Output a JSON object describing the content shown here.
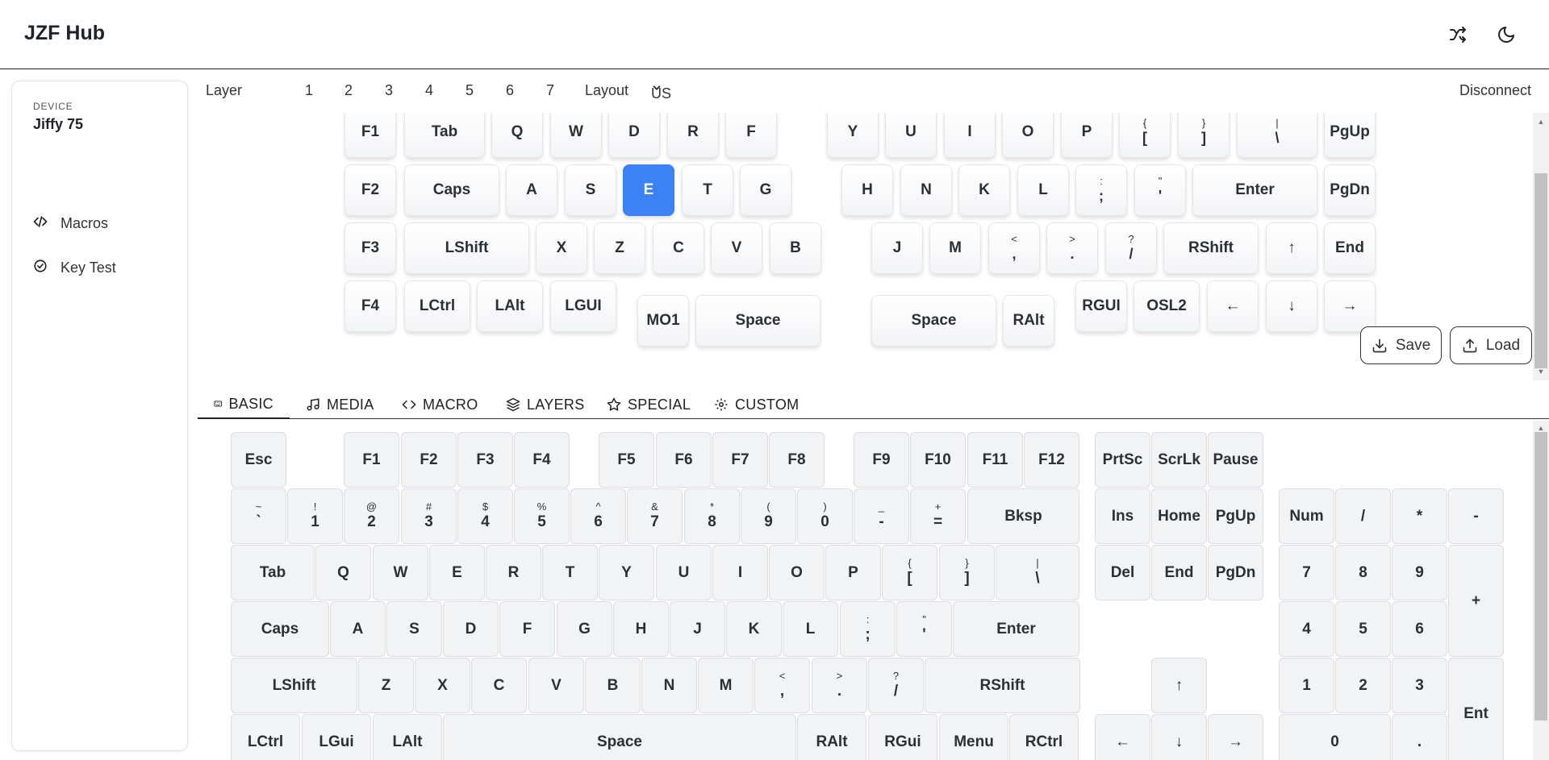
{
  "app": {
    "title": "JZF Hub"
  },
  "header": {
    "icons": [
      "shuffle-icon",
      "moon-icon"
    ]
  },
  "sidebar": {
    "device_label": "DEVICE",
    "device_name": "Jiffy 75",
    "items": [
      {
        "label": "Macros",
        "icon": "code-icon"
      },
      {
        "label": "Key Test",
        "icon": "check-circle-icon"
      }
    ]
  },
  "topbar": {
    "layer_label": "Layer",
    "layers": [
      "1",
      "2",
      "3",
      "4",
      "5",
      "6",
      "7"
    ],
    "layout_label": "Layout",
    "layout_value": "US",
    "disconnect_label": "Disconnect"
  },
  "actions": {
    "save_label": "Save",
    "load_label": "Load"
  },
  "keymap": {
    "selected": "E",
    "keys": [
      {
        "l": "F1"
      },
      {
        "l": "Tab"
      },
      {
        "l": "Q"
      },
      {
        "l": "W"
      },
      {
        "l": "D"
      },
      {
        "l": "R"
      },
      {
        "l": "F"
      },
      {
        "l": "Y"
      },
      {
        "l": "U"
      },
      {
        "l": "I"
      },
      {
        "l": "O"
      },
      {
        "l": "P"
      },
      {
        "s": "{",
        "l": "["
      },
      {
        "s": "}",
        "l": "]"
      },
      {
        "s": "|",
        "l": "\\"
      },
      {
        "l": "PgUp"
      },
      {
        "l": "F2"
      },
      {
        "l": "Caps"
      },
      {
        "l": "A"
      },
      {
        "l": "S"
      },
      {
        "l": "E"
      },
      {
        "l": "T"
      },
      {
        "l": "G"
      },
      {
        "l": "H"
      },
      {
        "l": "N"
      },
      {
        "l": "K"
      },
      {
        "l": "L"
      },
      {
        "s": ":",
        "l": ";"
      },
      {
        "s": "\"",
        "l": "'"
      },
      {
        "l": "Enter"
      },
      {
        "l": "PgDn"
      },
      {
        "l": "F3"
      },
      {
        "l": "LShift"
      },
      {
        "l": "X"
      },
      {
        "l": "Z"
      },
      {
        "l": "C"
      },
      {
        "l": "V"
      },
      {
        "l": "B"
      },
      {
        "l": "J"
      },
      {
        "l": "M"
      },
      {
        "s": "<",
        "l": ","
      },
      {
        "s": ">",
        "l": "."
      },
      {
        "s": "?",
        "l": "/"
      },
      {
        "l": "RShift"
      },
      {
        "l": "↑"
      },
      {
        "l": "End"
      },
      {
        "l": "F4"
      },
      {
        "l": "LCtrl"
      },
      {
        "l": "LAlt"
      },
      {
        "l": "LGUI"
      },
      {
        "l": "MO1"
      },
      {
        "l": "Space"
      },
      {
        "l": "Space"
      },
      {
        "l": "RAlt"
      },
      {
        "l": "RGUI"
      },
      {
        "l": "OSL2"
      },
      {
        "l": "←"
      },
      {
        "l": "↓"
      },
      {
        "l": "→"
      }
    ]
  },
  "tabs": [
    {
      "label": "BASIC",
      "icon": "keyboard-icon",
      "active": true
    },
    {
      "label": "MEDIA",
      "icon": "music-icon"
    },
    {
      "label": "MACRO",
      "icon": "code-icon"
    },
    {
      "label": "LAYERS",
      "icon": "layers-icon"
    },
    {
      "label": "SPECIAL",
      "icon": "star-icon"
    },
    {
      "label": "CUSTOM",
      "icon": "gear-icon"
    }
  ],
  "palette": {
    "keys": [
      {
        "l": "Esc"
      },
      {
        "l": "F1"
      },
      {
        "l": "F2"
      },
      {
        "l": "F3"
      },
      {
        "l": "F4"
      },
      {
        "l": "F5"
      },
      {
        "l": "F6"
      },
      {
        "l": "F7"
      },
      {
        "l": "F8"
      },
      {
        "l": "F9"
      },
      {
        "l": "F10"
      },
      {
        "l": "F11"
      },
      {
        "l": "F12"
      },
      {
        "l": "PrtSc"
      },
      {
        "l": "ScrLk"
      },
      {
        "l": "Pause"
      },
      {
        "s": "~",
        "l": "`"
      },
      {
        "s": "!",
        "l": "1"
      },
      {
        "s": "@",
        "l": "2"
      },
      {
        "s": "#",
        "l": "3"
      },
      {
        "s": "$",
        "l": "4"
      },
      {
        "s": "%",
        "l": "5"
      },
      {
        "s": "^",
        "l": "6"
      },
      {
        "s": "&",
        "l": "7"
      },
      {
        "s": "*",
        "l": "8"
      },
      {
        "s": "(",
        "l": "9"
      },
      {
        "s": ")",
        "l": "0"
      },
      {
        "s": "_",
        "l": "-"
      },
      {
        "s": "+",
        "l": "="
      },
      {
        "l": "Bksp"
      },
      {
        "l": "Ins"
      },
      {
        "l": "Home"
      },
      {
        "l": "PgUp"
      },
      {
        "l": "Num"
      },
      {
        "l": "/"
      },
      {
        "l": "*"
      },
      {
        "l": "-"
      },
      {
        "l": "Tab"
      },
      {
        "l": "Q"
      },
      {
        "l": "W"
      },
      {
        "l": "E"
      },
      {
        "l": "R"
      },
      {
        "l": "T"
      },
      {
        "l": "Y"
      },
      {
        "l": "U"
      },
      {
        "l": "I"
      },
      {
        "l": "O"
      },
      {
        "l": "P"
      },
      {
        "s": "{",
        "l": "["
      },
      {
        "s": "}",
        "l": "]"
      },
      {
        "s": "|",
        "l": "\\"
      },
      {
        "l": "Del"
      },
      {
        "l": "End"
      },
      {
        "l": "PgDn"
      },
      {
        "l": "7"
      },
      {
        "l": "8"
      },
      {
        "l": "9"
      },
      {
        "l": "+"
      },
      {
        "l": "Caps"
      },
      {
        "l": "A"
      },
      {
        "l": "S"
      },
      {
        "l": "D"
      },
      {
        "l": "F"
      },
      {
        "l": "G"
      },
      {
        "l": "H"
      },
      {
        "l": "J"
      },
      {
        "l": "K"
      },
      {
        "l": "L"
      },
      {
        "s": ":",
        "l": ";"
      },
      {
        "s": "\"",
        "l": "'"
      },
      {
        "l": "Enter"
      },
      {
        "l": "4"
      },
      {
        "l": "5"
      },
      {
        "l": "6"
      },
      {
        "l": "LShift"
      },
      {
        "l": "Z"
      },
      {
        "l": "X"
      },
      {
        "l": "C"
      },
      {
        "l": "V"
      },
      {
        "l": "B"
      },
      {
        "l": "N"
      },
      {
        "l": "M"
      },
      {
        "s": "<",
        "l": ","
      },
      {
        "s": ">",
        "l": "."
      },
      {
        "s": "?",
        "l": "/"
      },
      {
        "l": "RShift"
      },
      {
        "l": "↑"
      },
      {
        "l": "1"
      },
      {
        "l": "2"
      },
      {
        "l": "3"
      },
      {
        "l": "Ent"
      },
      {
        "l": "LCtrl"
      },
      {
        "l": "LGui"
      },
      {
        "l": "LAlt"
      },
      {
        "l": "Space"
      },
      {
        "l": "RAlt"
      },
      {
        "l": "RGui"
      },
      {
        "l": "Menu"
      },
      {
        "l": "RCtrl"
      },
      {
        "l": "←"
      },
      {
        "l": "↓"
      },
      {
        "l": "→"
      },
      {
        "l": "0"
      },
      {
        "l": "."
      }
    ]
  },
  "colors": {
    "accent": "#3b82f6",
    "border": "#222222"
  }
}
